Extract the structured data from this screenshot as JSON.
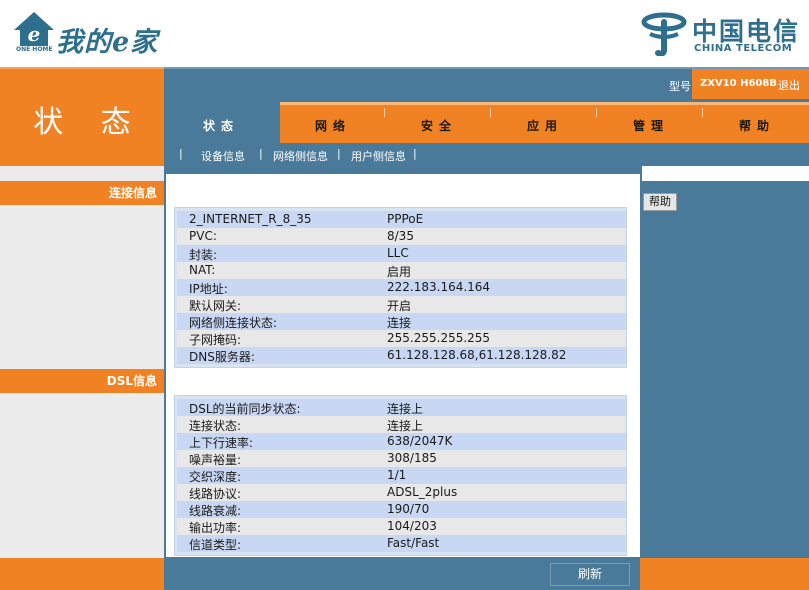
{
  "brand": {
    "title": "我的e家",
    "subtitle": "ONE HOME",
    "carrier_cn": "中国电信",
    "carrier_en": "CHINA TELECOM"
  },
  "header": {
    "model_label": "型号",
    "model_value": "ZXV10  H608B",
    "logout": "退出"
  },
  "page_title": "状 态",
  "tabs": [
    {
      "label": "状态",
      "active": true
    },
    {
      "label": "网络",
      "active": false
    },
    {
      "label": "安全",
      "active": false
    },
    {
      "label": "应用",
      "active": false
    },
    {
      "label": "管理",
      "active": false
    },
    {
      "label": "帮助",
      "active": false
    }
  ],
  "subnav": [
    {
      "label": "设备信息"
    },
    {
      "label": "网络侧信息"
    },
    {
      "label": "用户侧信息"
    }
  ],
  "sections": {
    "connection": {
      "label": "连接信息",
      "rows": [
        {
          "key": "2_INTERNET_R_8_35",
          "value": "PPPoE"
        },
        {
          "key": "PVC:",
          "value": "8/35"
        },
        {
          "key": "封装:",
          "value": "LLC"
        },
        {
          "key": "NAT:",
          "value": "启用"
        },
        {
          "key": "IP地址:",
          "value": "222.183.164.164"
        },
        {
          "key": "默认网关:",
          "value": "开启"
        },
        {
          "key": "网络侧连接状态:",
          "value": "连接"
        },
        {
          "key": "子网掩码:",
          "value": "255.255.255.255"
        },
        {
          "key": "DNS服务器:",
          "value": "61.128.128.68,61.128.128.82"
        }
      ]
    },
    "dsl": {
      "label": "DSL信息",
      "rows": [
        {
          "key": "DSL的当前同步状态:",
          "value": "连接上"
        },
        {
          "key": "连接状态:",
          "value": "连接上"
        },
        {
          "key": "上下行速率:",
          "value": "638/2047K"
        },
        {
          "key": "噪声裕量:",
          "value": "308/185"
        },
        {
          "key": "交织深度:",
          "value": "1/1"
        },
        {
          "key": "线路协议:",
          "value": "ADSL_2plus"
        },
        {
          "key": "线路衰减:",
          "value": "190/70"
        },
        {
          "key": "输出功率:",
          "value": "104/203"
        },
        {
          "key": "信道类型:",
          "value": "Fast/Fast"
        }
      ]
    }
  },
  "help_button": "帮助",
  "refresh_button": "刷新",
  "colors": {
    "orange": "#f08224",
    "steel_blue": "#4a7a99",
    "row_blue": "#c8d8f4",
    "row_gray": "#e8e8e8"
  }
}
